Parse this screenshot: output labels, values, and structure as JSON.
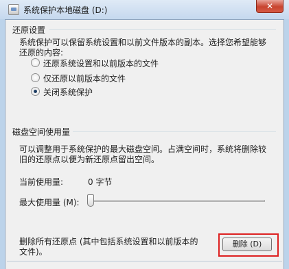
{
  "window": {
    "title": "系统保护本地磁盘 (D:)",
    "close_glyph": "✕"
  },
  "restore_settings": {
    "heading": "还原设置",
    "description_line1": "系统保护可以保留系统设置和以前文件版本的副本。选择您希望能够",
    "description_line2": "还原的内容:",
    "options": [
      {
        "label": "还原系统设置和以前版本的文件",
        "selected": false
      },
      {
        "label": "仅还原以前版本的文件",
        "selected": false
      },
      {
        "label": "关闭系统保护",
        "selected": true
      }
    ]
  },
  "disk_usage": {
    "heading": "磁盘空间使用量",
    "description_line1": "可以调整用于系统保护的最大磁盘空间。占满空间时，系统将删除较",
    "description_line2": "旧的还原点以便为新还原点留出空间。",
    "current_label": "当前使用量:",
    "current_value": "0 字节",
    "max_label": "最大使用量 (M):",
    "max_slider_fraction": 0
  },
  "delete_section": {
    "description_line1": "删除所有还原点 (其中包括系统设置和以前版本的",
    "description_line2": "文件)。",
    "button_label": "删除 (D)"
  },
  "colors": {
    "highlight": "#dd2020",
    "title_bar": "#c5d8ee",
    "close_button": "#c8442f"
  }
}
